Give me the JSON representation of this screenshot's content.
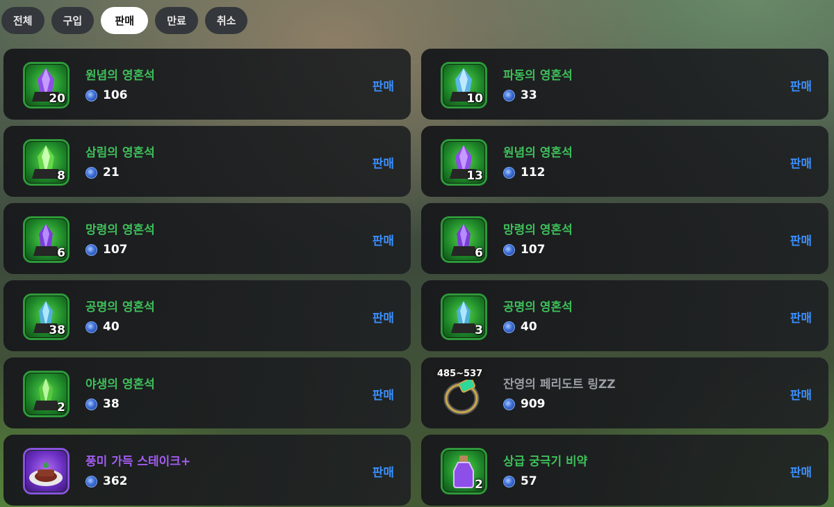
{
  "tabs": [
    {
      "label": "전체",
      "active": false
    },
    {
      "label": "구입",
      "active": false
    },
    {
      "label": "판매",
      "active": true
    },
    {
      "label": "만료",
      "active": false
    },
    {
      "label": "취소",
      "active": false
    }
  ],
  "colors": {
    "item_name_green": "#3ec05a",
    "item_name_gray": "#9a9ea4",
    "item_name_purple": "#a25df0",
    "sell_action_blue": "#3a8fff"
  },
  "items": [
    {
      "name": "원념의 영혼석",
      "count": "20",
      "price": "106",
      "action": "판매",
      "icon": "purple-soul-stone-icon"
    },
    {
      "name": "파동의 영혼석",
      "count": "10",
      "price": "33",
      "action": "판매",
      "icon": "blue-soul-stone-icon"
    },
    {
      "name": "삼림의 영혼석",
      "count": "8",
      "price": "21",
      "action": "판매",
      "icon": "green-soul-stone-icon"
    },
    {
      "name": "원념의 영혼석",
      "count": "13",
      "price": "112",
      "action": "판매",
      "icon": "purple-soul-stone-icon"
    },
    {
      "name": "망령의 영혼석",
      "count": "6",
      "price": "107",
      "action": "판매",
      "icon": "violet-soul-stone-icon"
    },
    {
      "name": "망령의 영혼석",
      "count": "6",
      "price": "107",
      "action": "판매",
      "icon": "violet-soul-stone-icon"
    },
    {
      "name": "공명의 영혼석",
      "count": "38",
      "price": "40",
      "action": "판매",
      "icon": "cyan-soul-stone-icon"
    },
    {
      "name": "공명의 영혼석",
      "count": "3",
      "price": "40",
      "action": "판매",
      "icon": "cyan-soul-stone-icon"
    },
    {
      "name": "야생의 영혼석",
      "count": "2",
      "price": "38",
      "action": "판매",
      "icon": "wild-green-soul-stone-icon"
    },
    {
      "name": "잔영의 페리도트 링ZZ",
      "range": "485~537",
      "price": "909",
      "action": "판매",
      "icon": "peridot-ring-icon"
    },
    {
      "name": "풍미 가득 스테이크+",
      "price": "362",
      "action": "판매",
      "icon": "steak-plate-icon"
    },
    {
      "name": "상급 궁극기 비약",
      "count": "2",
      "price": "57",
      "action": "판매",
      "icon": "purple-potion-icon"
    }
  ]
}
